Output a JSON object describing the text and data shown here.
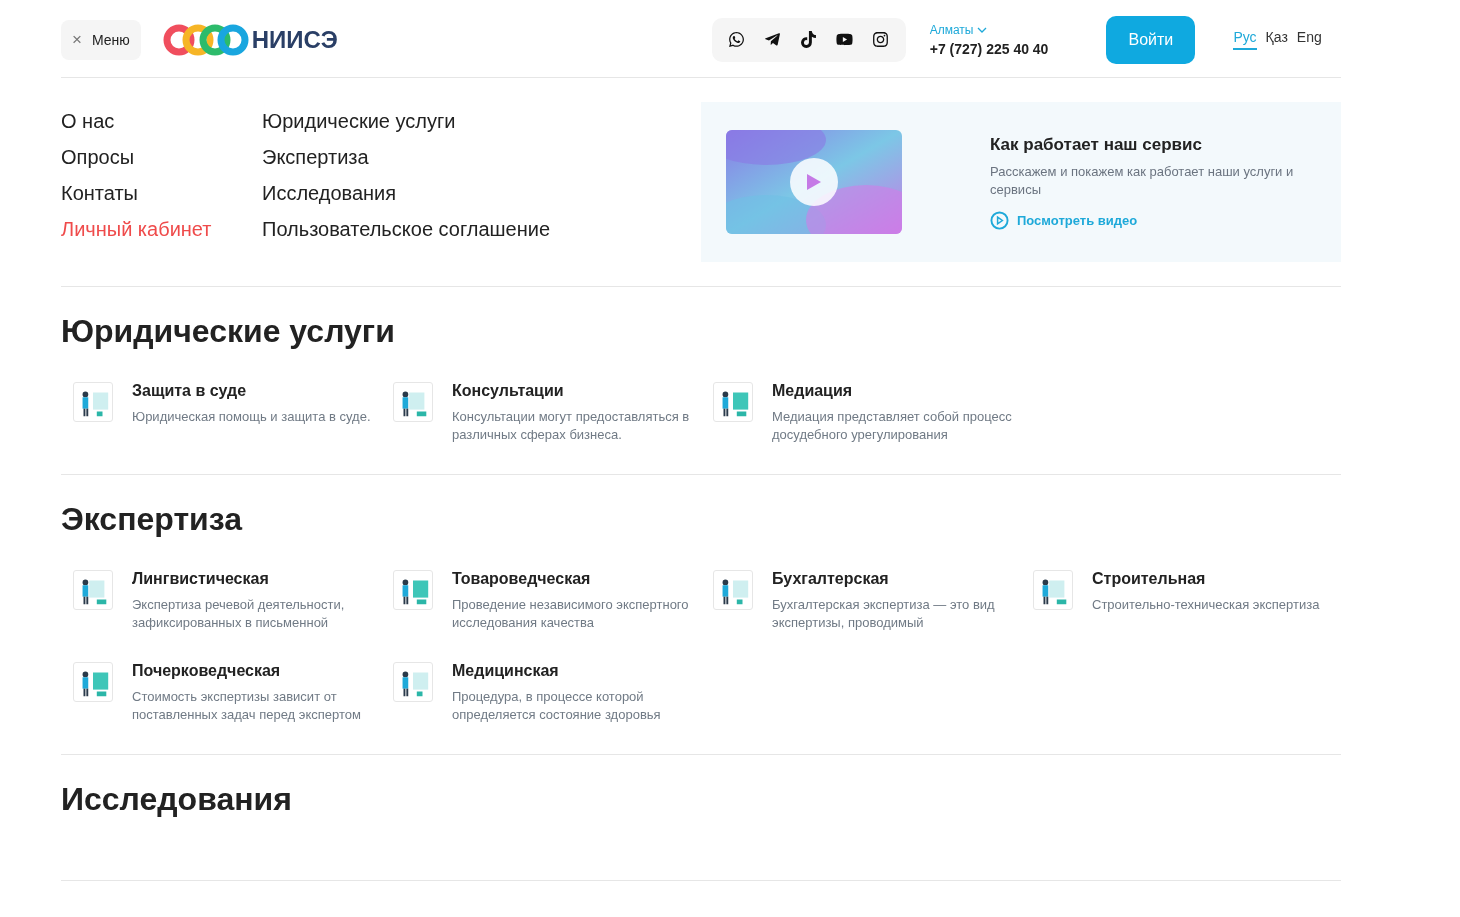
{
  "header": {
    "menu_button": {
      "icon": "×",
      "label": "Меню"
    },
    "logo": {
      "name": "НИИСЭ"
    },
    "socials": [
      {
        "kind": "whatsapp"
      },
      {
        "kind": "telegram"
      },
      {
        "kind": "tiktok"
      },
      {
        "kind": "youtube"
      },
      {
        "kind": "instagram"
      }
    ],
    "city": "Алматы",
    "phone": "+7 (727) 225 40 40",
    "login_button": "Войти",
    "languages": [
      {
        "label": "Рус",
        "selected": true
      },
      {
        "label": "Қаз",
        "selected": false
      },
      {
        "label": "Eng",
        "selected": false
      }
    ]
  },
  "menu": {
    "columns": [
      [
        {
          "label": "О нас",
          "accent": false
        },
        {
          "label": "Опросы",
          "accent": false
        },
        {
          "label": "Контаты",
          "accent": false
        },
        {
          "label": "Личный кабинет",
          "accent": true
        }
      ],
      [
        {
          "label": "Юридические услуги",
          "accent": false
        },
        {
          "label": "Экспертиза",
          "accent": false
        },
        {
          "label": "Исследования",
          "accent": false
        },
        {
          "label": "Пользовательское соглашение",
          "accent": false
        }
      ]
    ],
    "promo": {
      "title": "Как работает наш сервис",
      "text": "Расскажем и покажем как работает наши услуги и сервисы",
      "link": "Посмотреть видео"
    }
  },
  "sections": [
    {
      "title": "Юридические услуги",
      "items": [
        {
          "title": "Защита в суде",
          "text": "Юридическая помощь и защита в суде."
        },
        {
          "title": "Консультации",
          "text": "Консультации могут предоставляться в различных сферах бизнеса."
        },
        {
          "title": "Медиация",
          "text": "Медиация представляет собой процесс досудебного урегулирования"
        }
      ]
    },
    {
      "title": "Экспертиза",
      "items": [
        {
          "title": "Лингвистическая",
          "text": "Экспертиза речевой деятельности, зафиксированных в письменной"
        },
        {
          "title": "Товароведческая",
          "text": "Проведение независимого экспертного исследования качества"
        },
        {
          "title": "Бухгалтерская",
          "text": "Бухгалтерская экспертиза — это вид экспертизы, проводимый"
        },
        {
          "title": "Строительная",
          "text": "Строительно-техническая экспертиза"
        },
        {
          "title": "Почерковедческая",
          "text": "Стоимость экспертизы зависит от поставленных задач перед экспертом"
        },
        {
          "title": "Медицинская",
          "text": "Процедура, в процессе которой определяется состояние здоровья"
        }
      ]
    },
    {
      "title": "Исследования"
    }
  ]
}
